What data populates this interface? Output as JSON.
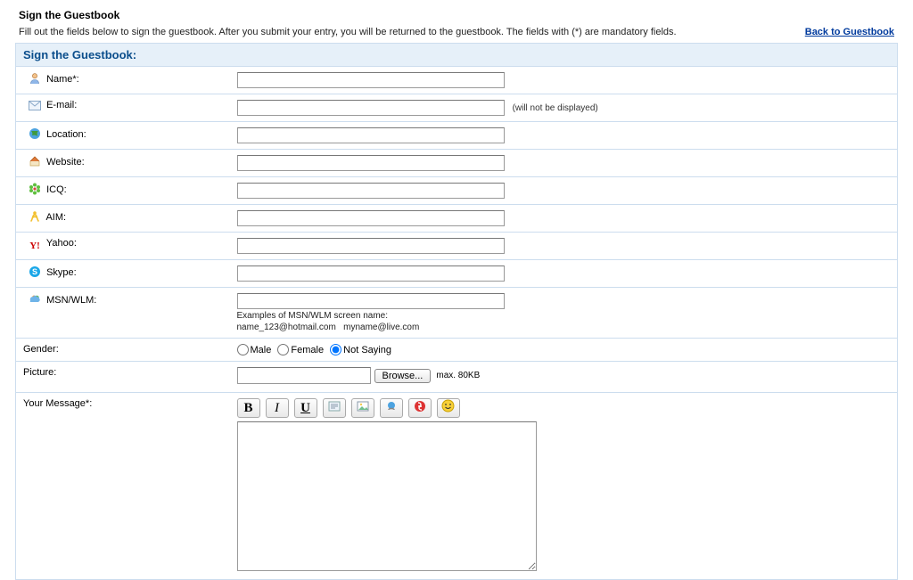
{
  "page": {
    "title": "Sign the Guestbook",
    "subtitle": "Fill out the fields below to sign the guestbook. After you submit your entry, you will be returned to the guestbook. The fields with (*) are mandatory fields.",
    "back_link": "Back to Guestbook",
    "section_header": "Sign the Guestbook:"
  },
  "fields": {
    "name": {
      "label": "Name*:",
      "value": ""
    },
    "email": {
      "label": "E-mail:",
      "value": "",
      "hint": "(will not be displayed)"
    },
    "location": {
      "label": "Location:",
      "value": ""
    },
    "website": {
      "label": "Website:",
      "value": ""
    },
    "icq": {
      "label": "ICQ:",
      "value": ""
    },
    "aim": {
      "label": "AIM:",
      "value": ""
    },
    "yahoo": {
      "label": "Yahoo:",
      "value": ""
    },
    "skype": {
      "label": "Skype:",
      "value": ""
    },
    "msn": {
      "label": "MSN/WLM:",
      "value": "",
      "example_intro": "Examples of MSN/WLM screen name:",
      "example_line": "name_123@hotmail.com   myname@live.com"
    },
    "gender": {
      "label": "Gender:",
      "options": {
        "male": "Male",
        "female": "Female",
        "not_saying": "Not Saying"
      },
      "selected": "not_saying"
    },
    "picture": {
      "label": "Picture:",
      "browse": "Browse...",
      "maxkb": "max. 80KB"
    },
    "message": {
      "label": "Your Message*:",
      "value": ""
    }
  },
  "toolbar": {
    "bold": "B",
    "italic": "I",
    "underline": "U"
  }
}
